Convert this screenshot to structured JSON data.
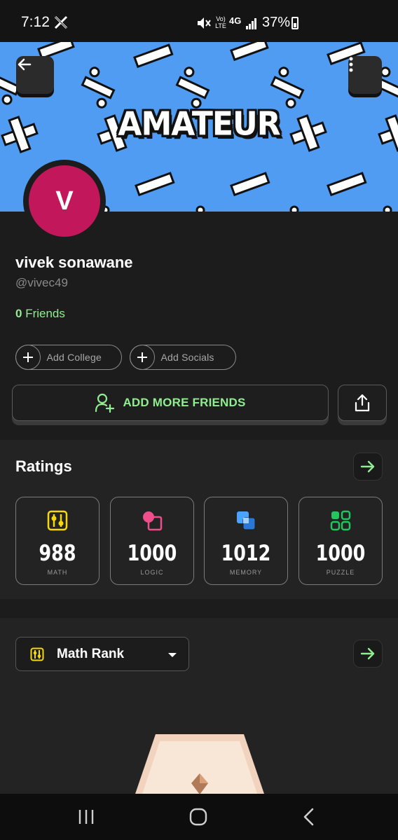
{
  "status_bar": {
    "time": "7:12",
    "battery": "37%",
    "network": "4G",
    "volte": "Vo) LTE"
  },
  "banner": {
    "title": "AMATEUR",
    "color": "#4f9cf2"
  },
  "profile": {
    "avatar_initial": "V",
    "avatar_color": "#c2185b",
    "name": "vivek sonawane",
    "handle": "@vivec49",
    "friends_count": "0",
    "friends_label": "Friends",
    "add_college": "Add College",
    "add_socials": "Add Socials",
    "add_friends": "ADD MORE FRIENDS"
  },
  "ratings": {
    "title": "Ratings",
    "cards": [
      {
        "value": "988",
        "label": "MATH",
        "icon": "math-icon",
        "color": "#f5d90a"
      },
      {
        "value": "1000",
        "label": "LOGIC",
        "icon": "logic-icon",
        "color": "#ee4f8c"
      },
      {
        "value": "1012",
        "label": "MEMORY",
        "icon": "memory-icon",
        "color": "#4aa3ff"
      },
      {
        "value": "1000",
        "label": "PUZZLE",
        "icon": "puzzle-icon",
        "color": "#22c55e"
      }
    ]
  },
  "rank": {
    "selected": "Math Rank"
  },
  "accent_green": "#90ee90"
}
